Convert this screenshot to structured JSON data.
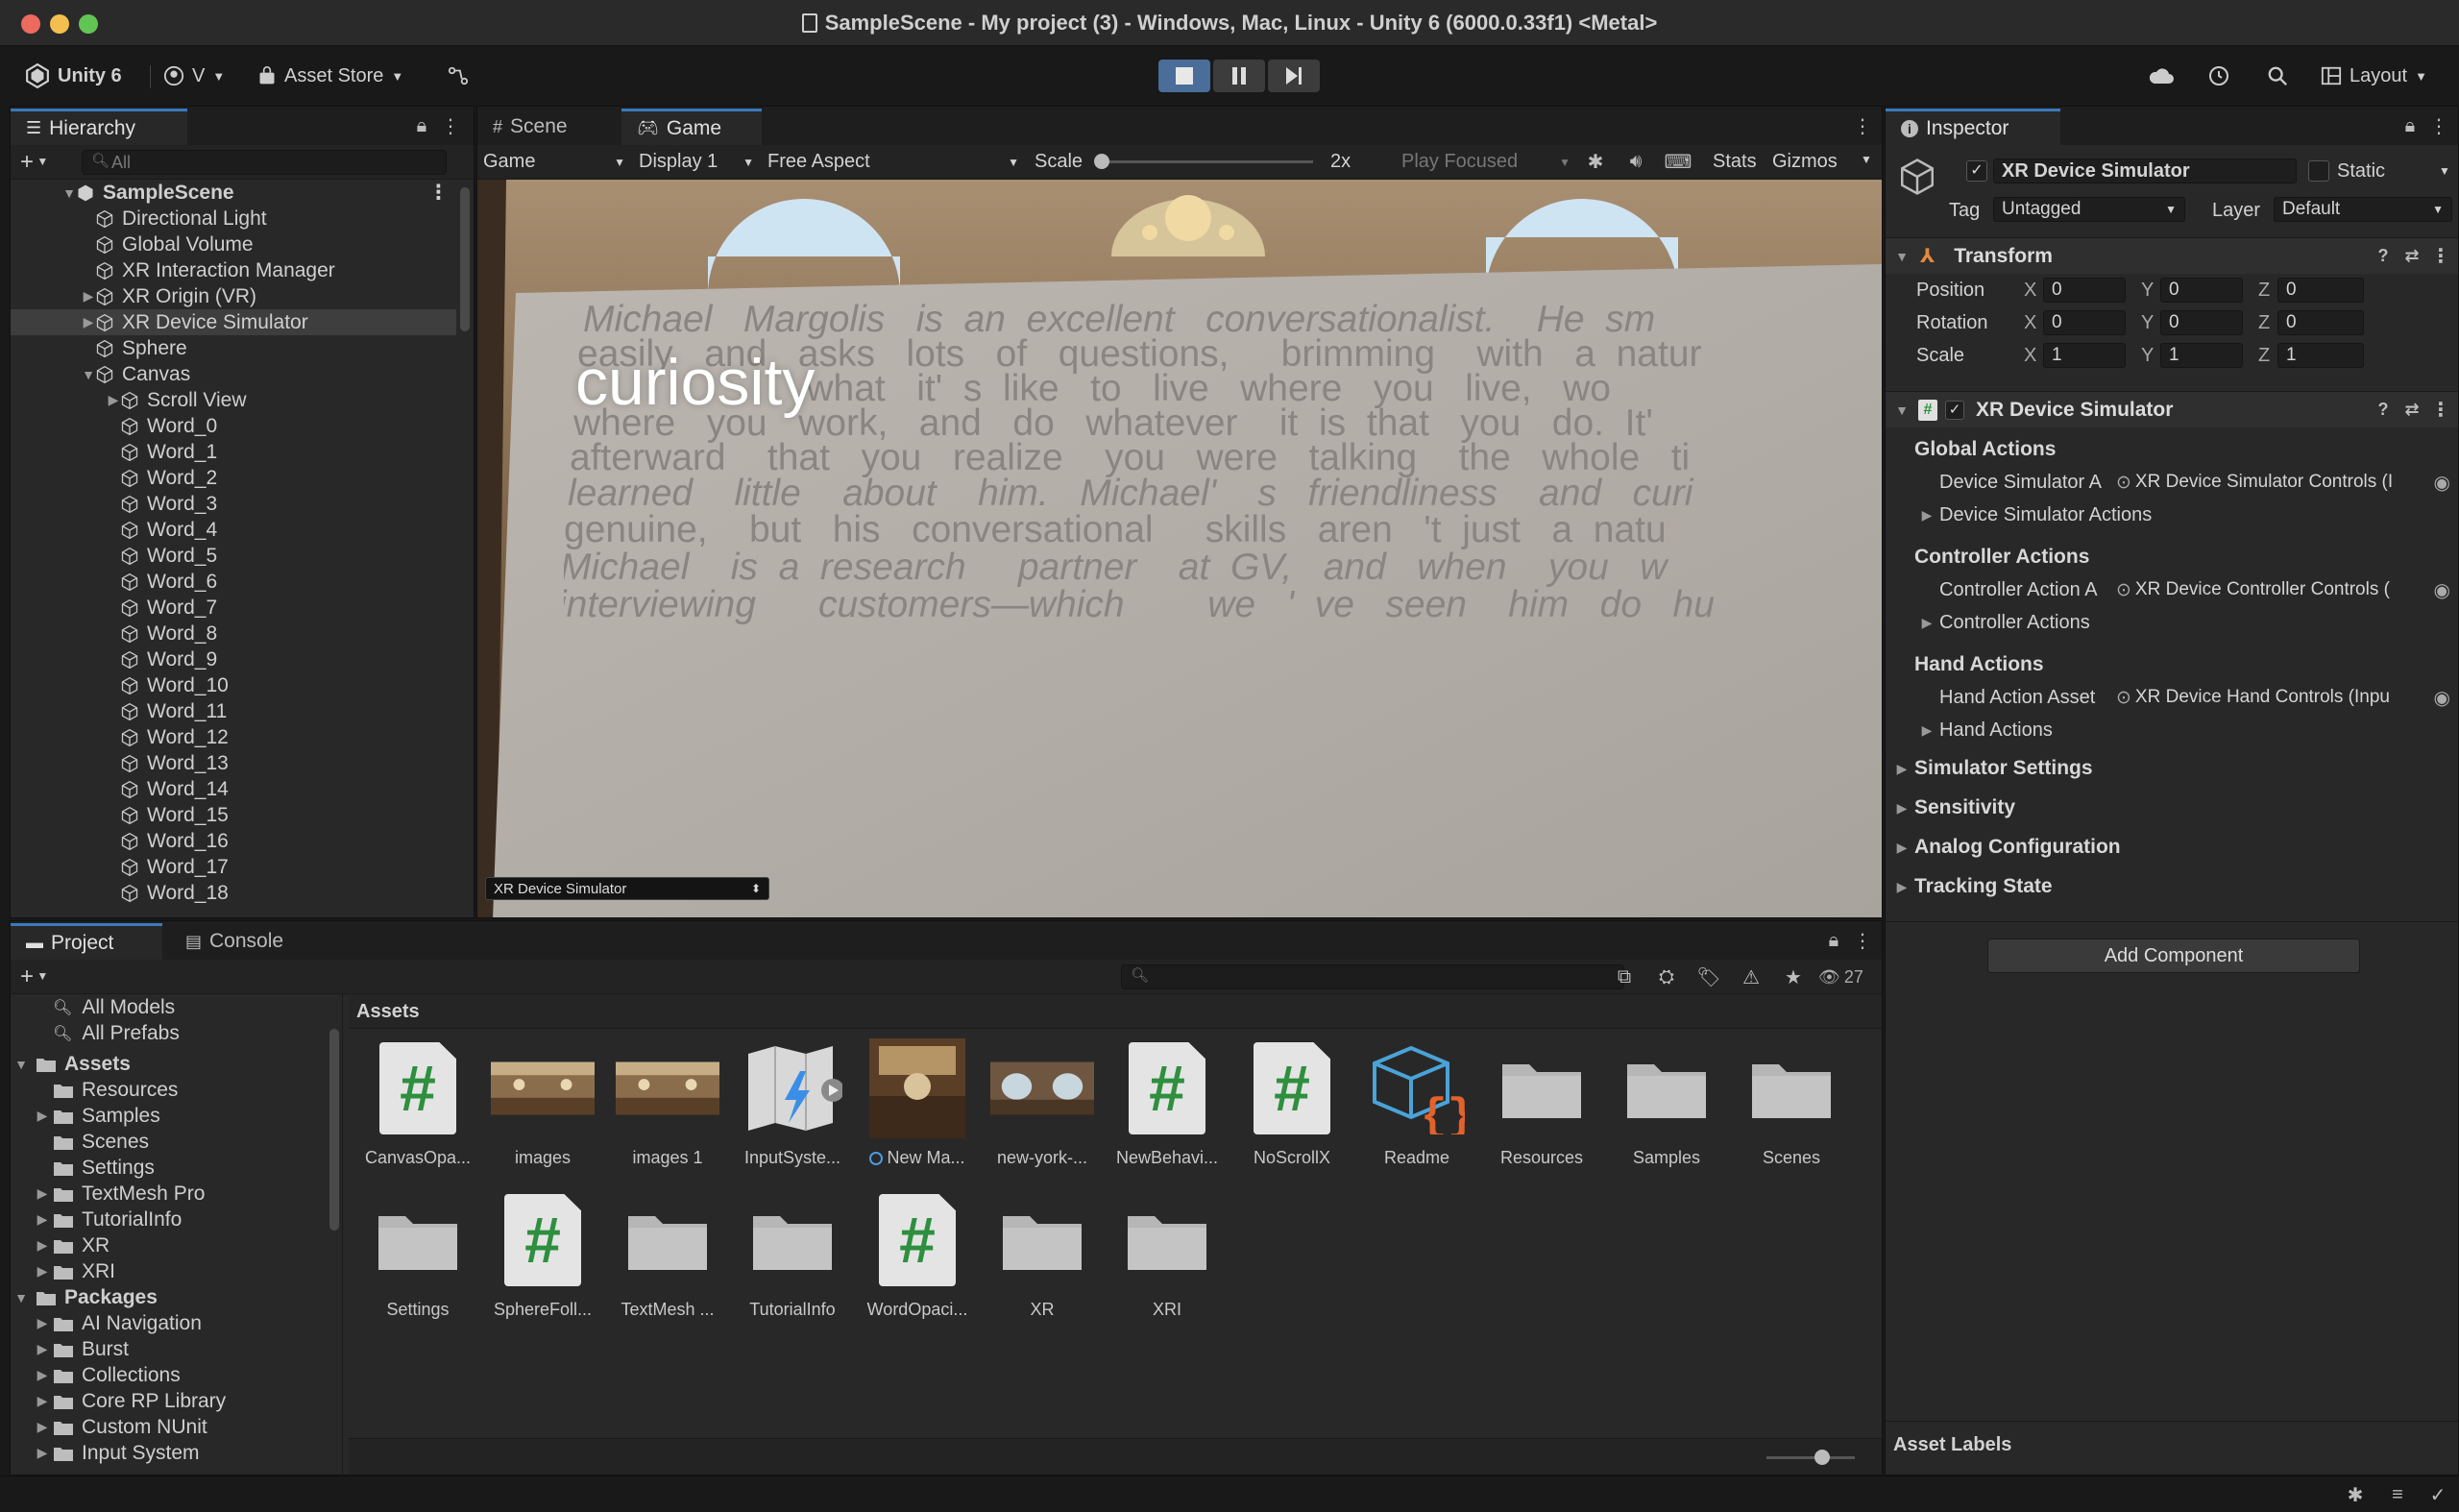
{
  "window": {
    "title": "SampleScene - My project (3) - Windows, Mac, Linux - Unity 6 (6000.0.33f1) <Metal>"
  },
  "toolbar": {
    "unity_label": "Unity 6",
    "account_label": "V",
    "asset_store_label": "Asset Store",
    "layout_label": "Layout"
  },
  "hierarchy": {
    "tab": "Hierarchy",
    "search_placeholder": "All",
    "scene": "SampleScene",
    "items": [
      {
        "label": "Directional Light"
      },
      {
        "label": "Global Volume"
      },
      {
        "label": "XR Interaction Manager"
      },
      {
        "label": "XR Origin (VR)"
      },
      {
        "label": "XR Device Simulator"
      },
      {
        "label": "Sphere"
      },
      {
        "label": "Canvas"
      },
      {
        "label": "Scroll View"
      },
      {
        "label": "Word_0"
      },
      {
        "label": "Word_1"
      },
      {
        "label": "Word_2"
      },
      {
        "label": "Word_3"
      },
      {
        "label": "Word_4"
      },
      {
        "label": "Word_5"
      },
      {
        "label": "Word_6"
      },
      {
        "label": "Word_7"
      },
      {
        "label": "Word_8"
      },
      {
        "label": "Word_9"
      },
      {
        "label": "Word_10"
      },
      {
        "label": "Word_11"
      },
      {
        "label": "Word_12"
      },
      {
        "label": "Word_13"
      },
      {
        "label": "Word_14"
      },
      {
        "label": "Word_15"
      },
      {
        "label": "Word_16"
      },
      {
        "label": "Word_17"
      },
      {
        "label": "Word_18"
      }
    ]
  },
  "view": {
    "tab_scene": "Scene",
    "tab_game": "Game",
    "mode": "Game",
    "display": "Display 1",
    "aspect": "Free Aspect",
    "scale_label": "Scale",
    "scale_value": "2x",
    "play_focused": "Play Focused",
    "stats": "Stats",
    "gizmos": "Gizmos",
    "overlay_dropdown": "XR Device Simulator",
    "highlight_word": "curiosity",
    "text_lines": [
      "Michael   Margolis   is  an  excellent   conversationalist.    He  sm",
      "easily   and   asks   lots   of   questions,     brimming    with   a  natur",
      "                      what   it'  s  like   to   live   where   you   live,   wo",
      "where   you   work,   and   do   whatever    it  is  that   you   do.  It'",
      "afterward    that   you   realize    you   were   talking    the   whole   ti",
      "learned    little    about    him.   Michael'    s   friendliness    and   curi",
      "genuine,    but   his   conversational     skills   aren   't  just   a  natu",
      "Michael    is  a  research     partner    at  GV,   and   when    you   w",
      "interviewing      customers—which        we   '  ve   seen    him   do   hu"
    ]
  },
  "inspector": {
    "tab": "Inspector",
    "object_name": "XR Device Simulator",
    "static_label": "Static",
    "tag_label": "Tag",
    "tag_value": "Untagged",
    "layer_label": "Layer",
    "layer_value": "Default",
    "transform": {
      "title": "Transform",
      "position_label": "Position",
      "rotation_label": "Rotation",
      "scale_label": "Scale",
      "x": "X",
      "y": "Y",
      "z": "Z",
      "position": [
        "0",
        "0",
        "0"
      ],
      "rotation": [
        "0",
        "0",
        "0"
      ],
      "scale": [
        "1",
        "1",
        "1"
      ]
    },
    "component": {
      "title": "XR Device Simulator",
      "global_actions": "Global Actions",
      "device_sim_field": "Device Simulator A",
      "device_sim_value": "XR Device Simulator Controls (I",
      "device_sim_actions": "Device Simulator Actions",
      "controller_actions": "Controller Actions",
      "controller_field": "Controller Action A",
      "controller_value": "XR Device Controller Controls (",
      "controller_actions_fold": "Controller Actions",
      "hand_actions": "Hand Actions",
      "hand_field": "Hand Action Asset",
      "hand_value": "XR Device Hand Controls (Inpu",
      "hand_actions_fold": "Hand Actions",
      "simulator_settings": "Simulator Settings",
      "sensitivity": "Sensitivity",
      "analog": "Analog Configuration",
      "tracking": "Tracking State"
    },
    "add_component": "Add Component",
    "asset_labels": "Asset Labels"
  },
  "project": {
    "tab_project": "Project",
    "tab_console": "Console",
    "hidden_count": "27",
    "breadcrumb": "Assets",
    "favorites": [
      "All Models",
      "All Prefabs"
    ],
    "assets_root": "Assets",
    "asset_folders": [
      "Resources",
      "Samples",
      "Scenes",
      "Settings",
      "TextMesh Pro",
      "TutorialInfo",
      "XR",
      "XRI"
    ],
    "packages_root": "Packages",
    "package_folders": [
      "AI Navigation",
      "Burst",
      "Collections",
      "Core RP Library",
      "Custom NUnit",
      "Input System"
    ],
    "grid": [
      {
        "label": "CanvasOpa...",
        "kind": "script"
      },
      {
        "label": "images",
        "kind": "pano"
      },
      {
        "label": "images 1",
        "kind": "pano"
      },
      {
        "label": "InputSyste...",
        "kind": "input"
      },
      {
        "label": "New Ma...",
        "kind": "material"
      },
      {
        "label": "new-york-...",
        "kind": "pano2"
      },
      {
        "label": "NewBehavi...",
        "kind": "script"
      },
      {
        "label": "NoScrollX",
        "kind": "script"
      },
      {
        "label": "Readme",
        "kind": "readme"
      },
      {
        "label": "Resources",
        "kind": "folder"
      },
      {
        "label": "Samples",
        "kind": "folder"
      },
      {
        "label": "Scenes",
        "kind": "folder"
      },
      {
        "label": "Settings",
        "kind": "folder"
      },
      {
        "label": "SphereFoll...",
        "kind": "script"
      },
      {
        "label": "TextMesh ...",
        "kind": "folder"
      },
      {
        "label": "TutorialInfo",
        "kind": "folder"
      },
      {
        "label": "WordOpaci...",
        "kind": "script"
      },
      {
        "label": "XR",
        "kind": "folder"
      },
      {
        "label": "XRI",
        "kind": "folder"
      }
    ]
  },
  "colors": {
    "accent": "#3a79bb",
    "script_green": "#2e8f3e",
    "panel": "#282828",
    "background": "#191919"
  }
}
